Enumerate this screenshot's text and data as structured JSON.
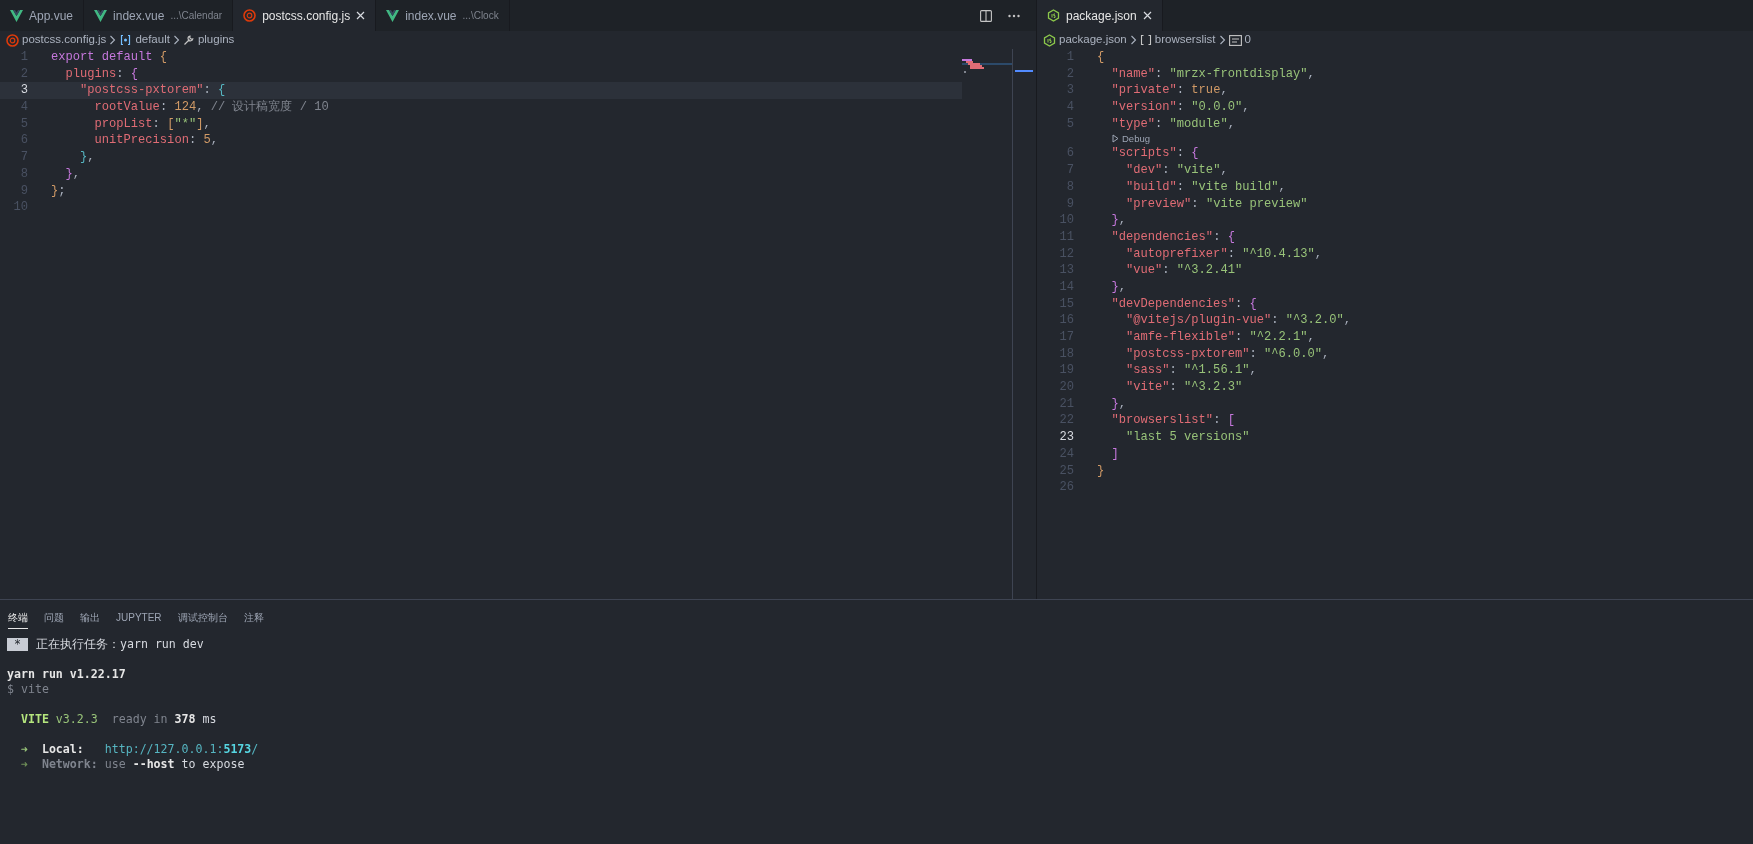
{
  "editor_groups": [
    {
      "tabs": [
        {
          "label": "App.vue",
          "kind": "vue",
          "selected": false
        },
        {
          "label": "index.vue",
          "detail": "...\\Calendar",
          "kind": "vue",
          "selected": false
        },
        {
          "label": "postcss.config.js",
          "kind": "postcss",
          "selected": true
        },
        {
          "label": "index.vue",
          "detail": "...\\Clock",
          "kind": "vue",
          "selected": false
        }
      ],
      "breadcrumbs": [
        {
          "label": "postcss.config.js",
          "kind": "postcss"
        },
        {
          "label": "default",
          "kind": "braces"
        },
        {
          "label": "plugins",
          "kind": "wrench"
        }
      ],
      "lines": [
        {
          "kind": "code",
          "number": "1",
          "current": false,
          "tokens": [
            {
              "t": "export",
              "kind": "kw"
            },
            {
              "t": " default",
              "kind": "kw"
            },
            {
              "t": " {",
              "kind": "b1"
            }
          ]
        },
        {
          "kind": "code",
          "number": "2",
          "current": false,
          "tokens": [
            {
              "t": "  plugins",
              "kind": "key"
            },
            {
              "t": ": ",
              "kind": "p"
            },
            {
              "t": "{",
              "kind": "b2"
            }
          ]
        },
        {
          "kind": "code",
          "number": "3",
          "current": true,
          "tokens": [
            {
              "t": "    \"postcss-pxtorem\"",
              "kind": "key"
            },
            {
              "t": ": ",
              "kind": "p"
            },
            {
              "t": "{",
              "kind": "b3"
            }
          ]
        },
        {
          "kind": "code",
          "number": "4",
          "current": false,
          "tokens": [
            {
              "t": "      rootValue",
              "kind": "key"
            },
            {
              "t": ": ",
              "kind": "p"
            },
            {
              "t": "124",
              "kind": "num"
            },
            {
              "t": ", ",
              "kind": "p"
            },
            {
              "t": "// 设计稿宽度 / 10",
              "kind": "cm"
            }
          ]
        },
        {
          "kind": "code",
          "number": "5",
          "current": false,
          "tokens": [
            {
              "t": "      propList",
              "kind": "key"
            },
            {
              "t": ": ",
              "kind": "p"
            },
            {
              "t": "[",
              "kind": "b1"
            },
            {
              "t": "\"*\"",
              "kind": "str"
            },
            {
              "t": "]",
              "kind": "b1"
            },
            {
              "t": ",",
              "kind": "p"
            }
          ]
        },
        {
          "kind": "code",
          "number": "6",
          "current": false,
          "tokens": [
            {
              "t": "      unitPrecision",
              "kind": "key"
            },
            {
              "t": ": ",
              "kind": "p"
            },
            {
              "t": "5",
              "kind": "num"
            },
            {
              "t": ",",
              "kind": "p"
            }
          ]
        },
        {
          "kind": "code",
          "number": "7",
          "current": false,
          "tokens": [
            {
              "t": "    }",
              "kind": "b3"
            },
            {
              "t": ",",
              "kind": "p"
            }
          ]
        },
        {
          "kind": "code",
          "number": "8",
          "current": false,
          "tokens": [
            {
              "t": "  }",
              "kind": "b2"
            },
            {
              "t": ",",
              "kind": "p"
            }
          ]
        },
        {
          "kind": "code",
          "number": "9",
          "current": false,
          "tokens": [
            {
              "t": "}",
              "kind": "b1"
            },
            {
              "t": ";",
              "kind": "p"
            }
          ]
        },
        {
          "kind": "code",
          "number": "10",
          "current": false
        }
      ]
    },
    {
      "tabs": [
        {
          "label": "package.json",
          "kind": "json",
          "selected": true
        }
      ],
      "breadcrumbs": [
        {
          "label": "package.json",
          "kind": "json"
        },
        {
          "label": "browserslist",
          "kind": "brackets"
        },
        {
          "label": "0",
          "kind": "string"
        }
      ],
      "lines": [
        {
          "kind": "code",
          "number": "1",
          "current": false,
          "tokens": [
            {
              "t": "{",
              "kind": "b1"
            }
          ]
        },
        {
          "kind": "code",
          "number": "2",
          "current": false,
          "tokens": [
            {
              "t": "  \"name\"",
              "kind": "key"
            },
            {
              "t": ": ",
              "kind": "p"
            },
            {
              "t": "\"mrzx-frontdisplay\"",
              "kind": "str"
            },
            {
              "t": ",",
              "kind": "p"
            }
          ]
        },
        {
          "kind": "code",
          "number": "3",
          "current": false,
          "tokens": [
            {
              "t": "  \"private\"",
              "kind": "key"
            },
            {
              "t": ": ",
              "kind": "p"
            },
            {
              "t": "true",
              "kind": "num"
            },
            {
              "t": ",",
              "kind": "p"
            }
          ]
        },
        {
          "kind": "code",
          "number": "4",
          "current": false,
          "tokens": [
            {
              "t": "  \"version\"",
              "kind": "key"
            },
            {
              "t": ": ",
              "kind": "p"
            },
            {
              "t": "\"0.0.0\"",
              "kind": "str"
            },
            {
              "t": ",",
              "kind": "p"
            }
          ]
        },
        {
          "kind": "code",
          "number": "5",
          "current": false,
          "tokens": [
            {
              "t": "  \"type\"",
              "kind": "key"
            },
            {
              "t": ": ",
              "kind": "p"
            },
            {
              "t": "\"module\"",
              "kind": "str"
            },
            {
              "t": ",",
              "kind": "p"
            }
          ]
        },
        {
          "kind": "codelens",
          "label": "Debug"
        },
        {
          "kind": "code",
          "number": "6",
          "current": false,
          "tokens": [
            {
              "t": "  \"scripts\"",
              "kind": "key"
            },
            {
              "t": ": ",
              "kind": "p"
            },
            {
              "t": "{",
              "kind": "b2"
            }
          ]
        },
        {
          "kind": "code",
          "number": "7",
          "current": false,
          "tokens": [
            {
              "t": "    \"dev\"",
              "kind": "key"
            },
            {
              "t": ": ",
              "kind": "p"
            },
            {
              "t": "\"vite\"",
              "kind": "str"
            },
            {
              "t": ",",
              "kind": "p"
            }
          ]
        },
        {
          "kind": "code",
          "number": "8",
          "current": false,
          "tokens": [
            {
              "t": "    \"build\"",
              "kind": "key"
            },
            {
              "t": ": ",
              "kind": "p"
            },
            {
              "t": "\"vite build\"",
              "kind": "str"
            },
            {
              "t": ",",
              "kind": "p"
            }
          ]
        },
        {
          "kind": "code",
          "number": "9",
          "current": false,
          "tokens": [
            {
              "t": "    \"preview\"",
              "kind": "key"
            },
            {
              "t": ": ",
              "kind": "p"
            },
            {
              "t": "\"vite preview\"",
              "kind": "str"
            }
          ]
        },
        {
          "kind": "code",
          "number": "10",
          "current": false,
          "tokens": [
            {
              "t": "  }",
              "kind": "b2"
            },
            {
              "t": ",",
              "kind": "p"
            }
          ]
        },
        {
          "kind": "code",
          "number": "11",
          "current": false,
          "tokens": [
            {
              "t": "  \"dependencies\"",
              "kind": "key"
            },
            {
              "t": ": ",
              "kind": "p"
            },
            {
              "t": "{",
              "kind": "b2"
            }
          ]
        },
        {
          "kind": "code",
          "number": "12",
          "current": false,
          "tokens": [
            {
              "t": "    \"autoprefixer\"",
              "kind": "key"
            },
            {
              "t": ": ",
              "kind": "p"
            },
            {
              "t": "\"^10.4.13\"",
              "kind": "str"
            },
            {
              "t": ",",
              "kind": "p"
            }
          ]
        },
        {
          "kind": "code",
          "number": "13",
          "current": false,
          "tokens": [
            {
              "t": "    \"vue\"",
              "kind": "key"
            },
            {
              "t": ": ",
              "kind": "p"
            },
            {
              "t": "\"^3.2.41\"",
              "kind": "str"
            }
          ]
        },
        {
          "kind": "code",
          "number": "14",
          "current": false,
          "tokens": [
            {
              "t": "  }",
              "kind": "b2"
            },
            {
              "t": ",",
              "kind": "p"
            }
          ]
        },
        {
          "kind": "code",
          "number": "15",
          "current": false,
          "tokens": [
            {
              "t": "  \"devDependencies\"",
              "kind": "key"
            },
            {
              "t": ": ",
              "kind": "p"
            },
            {
              "t": "{",
              "kind": "b2"
            }
          ]
        },
        {
          "kind": "code",
          "number": "16",
          "current": false,
          "tokens": [
            {
              "t": "    \"@vitejs/plugin-vue\"",
              "kind": "key"
            },
            {
              "t": ": ",
              "kind": "p"
            },
            {
              "t": "\"^3.2.0\"",
              "kind": "str"
            },
            {
              "t": ",",
              "kind": "p"
            }
          ]
        },
        {
          "kind": "code",
          "number": "17",
          "current": false,
          "tokens": [
            {
              "t": "    \"amfe-flexible\"",
              "kind": "key"
            },
            {
              "t": ": ",
              "kind": "p"
            },
            {
              "t": "\"^2.2.1\"",
              "kind": "str"
            },
            {
              "t": ",",
              "kind": "p"
            }
          ]
        },
        {
          "kind": "code",
          "number": "18",
          "current": false,
          "tokens": [
            {
              "t": "    \"postcss-pxtorem\"",
              "kind": "key"
            },
            {
              "t": ": ",
              "kind": "p"
            },
            {
              "t": "\"^6.0.0\"",
              "kind": "str"
            },
            {
              "t": ",",
              "kind": "p"
            }
          ]
        },
        {
          "kind": "code",
          "number": "19",
          "current": false,
          "tokens": [
            {
              "t": "    \"sass\"",
              "kind": "key"
            },
            {
              "t": ": ",
              "kind": "p"
            },
            {
              "t": "\"^1.56.1\"",
              "kind": "str"
            },
            {
              "t": ",",
              "kind": "p"
            }
          ]
        },
        {
          "kind": "code",
          "number": "20",
          "current": false,
          "tokens": [
            {
              "t": "    \"vite\"",
              "kind": "key"
            },
            {
              "t": ": ",
              "kind": "p"
            },
            {
              "t": "\"^3.2.3\"",
              "kind": "str"
            }
          ]
        },
        {
          "kind": "code",
          "number": "21",
          "current": false,
          "tokens": [
            {
              "t": "  }",
              "kind": "b2"
            },
            {
              "t": ",",
              "kind": "p"
            }
          ]
        },
        {
          "kind": "code",
          "number": "22",
          "current": false,
          "tokens": [
            {
              "t": "  \"browserslist\"",
              "kind": "key"
            },
            {
              "t": ": ",
              "kind": "p"
            },
            {
              "t": "[",
              "kind": "b2"
            }
          ]
        },
        {
          "kind": "code",
          "number": "23",
          "current": true,
          "tokens": [
            {
              "t": "    \"last 5 versions\"",
              "kind": "str"
            }
          ]
        },
        {
          "kind": "code",
          "number": "24",
          "current": false,
          "tokens": [
            {
              "t": "  ]",
              "kind": "b2"
            }
          ]
        },
        {
          "kind": "code",
          "number": "25",
          "current": false,
          "tokens": [
            {
              "t": "}",
              "kind": "b1"
            }
          ]
        },
        {
          "kind": "code",
          "number": "26",
          "current": false
        }
      ]
    }
  ],
  "panel": {
    "tabs": [
      {
        "label": "终端",
        "selected": true
      },
      {
        "label": "问题",
        "selected": false
      },
      {
        "label": "输出",
        "selected": false
      },
      {
        "label": "JUPYTER",
        "selected": false
      },
      {
        "label": "调试控制台",
        "selected": false
      },
      {
        "label": "注释",
        "selected": false
      }
    ],
    "terminal_lines": [
      {
        "kind": "text",
        "badge": "*",
        "tokens": [
          {
            "t": "正在执行任务：yarn run dev",
            "kind": "text"
          }
        ]
      },
      {
        "kind": "blank"
      },
      {
        "kind": "text",
        "tokens": [
          {
            "t": "yarn run v1.22.17",
            "kind": "bold"
          }
        ]
      },
      {
        "kind": "text",
        "tokens": [
          {
            "t": "$ vite",
            "kind": "dim"
          }
        ]
      },
      {
        "kind": "blank"
      },
      {
        "kind": "text",
        "tokens": [
          {
            "t": "  VITE",
            "kind": "greenbold"
          },
          {
            "t": " v3.2.3",
            "kind": "green"
          },
          {
            "t": "  ready in ",
            "kind": "dim"
          },
          {
            "t": "378",
            "kind": "bold"
          },
          {
            "t": " ms",
            "kind": "text"
          }
        ]
      },
      {
        "kind": "blank"
      },
      {
        "kind": "text",
        "tokens": [
          {
            "t": "  ➜",
            "kind": "green"
          },
          {
            "t": "  Local:",
            "kind": "bold"
          },
          {
            "t": "   http://127.0.0.1:",
            "kind": "cyan"
          },
          {
            "t": "5173",
            "kind": "cyanbold"
          },
          {
            "t": "/",
            "kind": "cyan"
          }
        ]
      },
      {
        "kind": "text",
        "tokens": [
          {
            "t": "  ➜",
            "kind": "greendim"
          },
          {
            "t": "  Network:",
            "kind": "dimbold"
          },
          {
            "t": " use ",
            "kind": "dim"
          },
          {
            "t": "--host",
            "kind": "bold"
          },
          {
            "t": " to expose",
            "kind": "text"
          }
        ]
      }
    ]
  }
}
